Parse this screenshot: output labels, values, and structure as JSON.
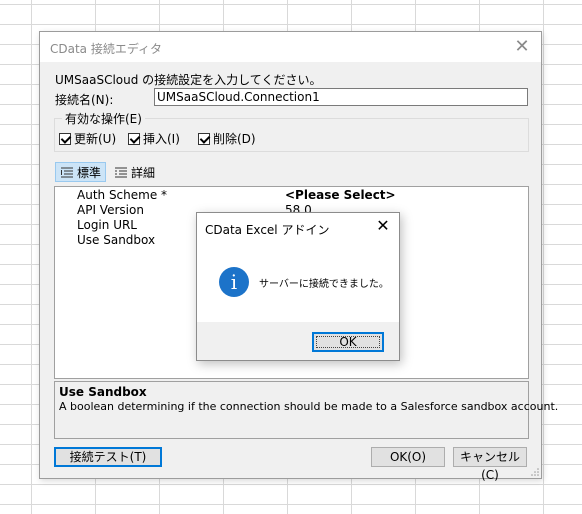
{
  "dialog": {
    "title": "CData 接続エディタ",
    "instruction": "UMSaaSCloud の接続設定を入力してください。",
    "connection_name_label": "接続名(N):",
    "connection_name_value": "UMSaaSCloud.Connection1",
    "operations_group_label": "有効な操作(E)",
    "checkboxes": [
      {
        "label": "更新(U)",
        "checked": true
      },
      {
        "label": "挿入(I)",
        "checked": true
      },
      {
        "label": "削除(D)",
        "checked": true
      }
    ],
    "tabs": [
      {
        "label": "標準",
        "active": true,
        "icon": "sort-list-icon"
      },
      {
        "label": "詳細",
        "active": false,
        "icon": "detail-list-icon"
      }
    ],
    "properties": [
      {
        "name": "Auth Scheme *",
        "value": "<Please Select>"
      },
      {
        "name": "API Version",
        "value": "58.0"
      },
      {
        "name": "Login URL",
        "value": ""
      },
      {
        "name": "Use Sandbox",
        "value": ""
      }
    ],
    "description": {
      "title": "Use Sandbox",
      "text": "A boolean determining if the connection should be made to a Salesforce sandbox account."
    },
    "buttons": {
      "test": "接続テスト(T)",
      "ok": "OK(O)",
      "cancel": "キャンセル(C)"
    },
    "close_icon": "close-icon"
  },
  "message_box": {
    "title": "CData Excel アドイン",
    "message": "サーバーに接続できました。",
    "icon": "info-icon",
    "ok_label": "OK",
    "accent_color": "#1c73c9"
  }
}
